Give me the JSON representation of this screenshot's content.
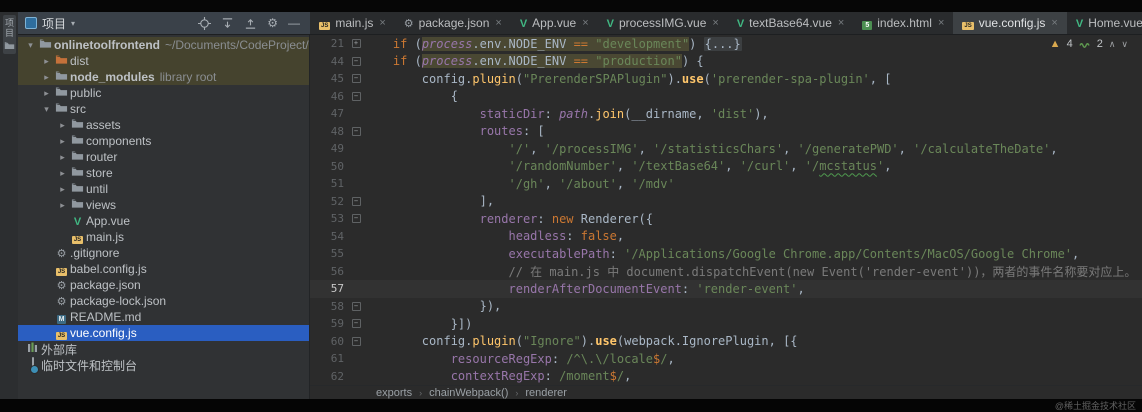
{
  "activity_bar": {
    "stripe_label": "项目"
  },
  "project_panel": {
    "header": {
      "title": "项目",
      "actions": [
        "locate",
        "expand-all",
        "collapse-all",
        "settings",
        "hide-panel"
      ]
    },
    "tree": [
      {
        "label": "onlinetoolfrontend",
        "suffix": "~/Documents/CodeProject/o",
        "icon": "folder",
        "level": 0,
        "chevron": "v",
        "bold": true,
        "hl": true
      },
      {
        "label": "dist",
        "icon": "folder-ex",
        "level": 1,
        "chevron": ">",
        "hl": true
      },
      {
        "label": "node_modules",
        "suffix": "library root",
        "icon": "folder",
        "level": 1,
        "chevron": ">",
        "bold": true,
        "hl": true
      },
      {
        "label": "public",
        "icon": "folder",
        "level": 1,
        "chevron": ">"
      },
      {
        "label": "src",
        "icon": "folder",
        "level": 1,
        "chevron": "v"
      },
      {
        "label": "assets",
        "icon": "folder",
        "level": 2,
        "chevron": ">"
      },
      {
        "label": "components",
        "icon": "folder",
        "level": 2,
        "chevron": ">"
      },
      {
        "label": "router",
        "icon": "folder",
        "level": 2,
        "chevron": ">"
      },
      {
        "label": "store",
        "icon": "folder",
        "level": 2,
        "chevron": ">"
      },
      {
        "label": "until",
        "icon": "folder",
        "level": 2,
        "chevron": ">"
      },
      {
        "label": "views",
        "icon": "folder",
        "level": 2,
        "chevron": ">"
      },
      {
        "label": "App.vue",
        "icon": "vue",
        "level": 2
      },
      {
        "label": "main.js",
        "icon": "js",
        "level": 2
      },
      {
        "label": ".gitignore",
        "icon": "gear",
        "level": 1
      },
      {
        "label": "babel.config.js",
        "icon": "js",
        "level": 1
      },
      {
        "label": "package.json",
        "icon": "json",
        "level": 1
      },
      {
        "label": "package-lock.json",
        "icon": "json",
        "level": 1
      },
      {
        "label": "README.md",
        "icon": "md",
        "level": 1
      },
      {
        "label": "vue.config.js",
        "icon": "js",
        "level": 1,
        "selected": true
      },
      {
        "label": "外部库",
        "icon": "lib",
        "level": 0
      },
      {
        "label": "临时文件和控制台",
        "icon": "scratch",
        "level": 0
      }
    ]
  },
  "editor": {
    "tabs": [
      {
        "label": "main.js",
        "icon": "js"
      },
      {
        "label": "package.json",
        "icon": "json"
      },
      {
        "label": "App.vue",
        "icon": "vue"
      },
      {
        "label": "processIMG.vue",
        "icon": "vue"
      },
      {
        "label": "textBase64.vue",
        "icon": "vue"
      },
      {
        "label": "index.html",
        "icon": "html"
      },
      {
        "label": "vue.config.js",
        "icon": "js",
        "active": true
      },
      {
        "label": "Home.vue",
        "icon": "vue"
      }
    ],
    "inspections": {
      "warnings": "4",
      "typos": "2"
    },
    "breadcrumbs": [
      "exports",
      "chainWebpack()",
      "renderer"
    ],
    "code": {
      "lines": [
        {
          "num": "21",
          "fold": "+",
          "segs": [
            [
              "    ",
              "def"
            ],
            [
              "if ",
              "kw"
            ],
            [
              "(",
              "def"
            ],
            [
              "process",
              "it",
              1
            ],
            [
              ".env.NODE_ENV ",
              "def",
              1
            ],
            [
              "== ",
              "kw",
              1
            ],
            [
              "\"development\"",
              "str",
              1
            ],
            [
              ") ",
              "def"
            ],
            [
              "{...}",
              "fold"
            ]
          ]
        },
        {
          "num": "44",
          "fold": "-",
          "segs": [
            [
              "    ",
              "def"
            ],
            [
              "if ",
              "kw"
            ],
            [
              "(",
              "def"
            ],
            [
              "process",
              "it",
              1
            ],
            [
              ".env.NODE_ENV ",
              "def",
              1
            ],
            [
              "== ",
              "kw",
              1
            ],
            [
              "\"production\"",
              "str",
              1
            ],
            [
              ") {",
              "def"
            ]
          ]
        },
        {
          "num": "45",
          "fold": "-",
          "segs": [
            [
              "        config.",
              "def"
            ],
            [
              "plugin",
              "fn"
            ],
            [
              "(",
              "def"
            ],
            [
              "\"PrerenderSPAPlugin\"",
              "str"
            ],
            [
              ").",
              "def"
            ],
            [
              "use",
              "fnb"
            ],
            [
              "(",
              "def"
            ],
            [
              "'prerender-spa-plugin'",
              "str"
            ],
            [
              ", [",
              "def"
            ]
          ]
        },
        {
          "num": "46",
          "fold": "-",
          "segs": [
            [
              "            {",
              "def"
            ]
          ]
        },
        {
          "num": "47",
          "segs": [
            [
              "                ",
              "def"
            ],
            [
              "staticDir",
              "prop"
            ],
            [
              ": ",
              "def"
            ],
            [
              "path",
              "it"
            ],
            [
              ".",
              "def"
            ],
            [
              "join",
              "fn"
            ],
            [
              "(__dirname, ",
              "def"
            ],
            [
              "'dist'",
              "str"
            ],
            [
              "),",
              "def"
            ]
          ]
        },
        {
          "num": "48",
          "fold": "-",
          "segs": [
            [
              "                ",
              "def"
            ],
            [
              "routes",
              "prop"
            ],
            [
              ": [",
              "def"
            ]
          ]
        },
        {
          "num": "49",
          "segs": [
            [
              "                    ",
              "def"
            ],
            [
              "'/'",
              "str"
            ],
            [
              ", ",
              "def"
            ],
            [
              "'/processIMG'",
              "str"
            ],
            [
              ", ",
              "def"
            ],
            [
              "'/statisticsChars'",
              "str"
            ],
            [
              ", ",
              "def"
            ],
            [
              "'/generatePWD'",
              "str"
            ],
            [
              ", ",
              "def"
            ],
            [
              "'/calculateTheDate'",
              "str"
            ],
            [
              ",",
              "def"
            ]
          ]
        },
        {
          "num": "50",
          "segs": [
            [
              "                    ",
              "def"
            ],
            [
              "'/randomNumber'",
              "str"
            ],
            [
              ", ",
              "def"
            ],
            [
              "'/textBase64'",
              "str"
            ],
            [
              ", ",
              "def"
            ],
            [
              "'/curl'",
              "str"
            ],
            [
              ", ",
              "def"
            ],
            [
              "'/",
              "str"
            ],
            [
              "mcstatus",
              "typo"
            ],
            [
              "'",
              "str"
            ],
            [
              ",",
              "def"
            ]
          ]
        },
        {
          "num": "51",
          "segs": [
            [
              "                    ",
              "def"
            ],
            [
              "'/gh'",
              "str"
            ],
            [
              ", ",
              "def"
            ],
            [
              "'/about'",
              "str"
            ],
            [
              ", ",
              "def"
            ],
            [
              "'/mdv'",
              "str"
            ]
          ]
        },
        {
          "num": "52",
          "fold": "-",
          "segs": [
            [
              "                ],",
              "def"
            ]
          ]
        },
        {
          "num": "53",
          "fold": "-",
          "segs": [
            [
              "                ",
              "def"
            ],
            [
              "renderer",
              "prop"
            ],
            [
              ": ",
              "def"
            ],
            [
              "new ",
              "kw"
            ],
            [
              "Renderer({",
              "def"
            ]
          ]
        },
        {
          "num": "54",
          "segs": [
            [
              "                    ",
              "def"
            ],
            [
              "headless",
              "prop"
            ],
            [
              ": ",
              "def"
            ],
            [
              "false",
              "kw"
            ],
            [
              ",",
              "def"
            ]
          ]
        },
        {
          "num": "55",
          "segs": [
            [
              "                    ",
              "def"
            ],
            [
              "executablePath",
              "prop"
            ],
            [
              ": ",
              "def"
            ],
            [
              "'/Applications/Google Chrome.app/Contents/MacOS/Google Chrome'",
              "str"
            ],
            [
              ",",
              "def"
            ]
          ]
        },
        {
          "num": "56",
          "segs": [
            [
              "                    ",
              "def"
            ],
            [
              "// 在 main.js 中 document.dispatchEvent(new Event('render-event'))，两者的事件名称要对应上。",
              "com"
            ]
          ]
        },
        {
          "num": "57",
          "cur": true,
          "segs": [
            [
              "                    ",
              "def"
            ],
            [
              "renderAfterDocumentEvent",
              "prop"
            ],
            [
              ": ",
              "def"
            ],
            [
              "'render-event'",
              "str"
            ],
            [
              ",",
              "def"
            ]
          ]
        },
        {
          "num": "58",
          "fold": "-",
          "segs": [
            [
              "                }),",
              "def"
            ]
          ]
        },
        {
          "num": "59",
          "fold": "-",
          "segs": [
            [
              "            }])",
              "def"
            ]
          ]
        },
        {
          "num": "60",
          "fold": "-",
          "segs": [
            [
              "        config.",
              "def"
            ],
            [
              "plugin",
              "fn"
            ],
            [
              "(",
              "def"
            ],
            [
              "\"Ignore\"",
              "str"
            ],
            [
              ").",
              "def"
            ],
            [
              "use",
              "fnb"
            ],
            [
              "(webpack.IgnorePlugin, [{",
              "def"
            ]
          ]
        },
        {
          "num": "61",
          "segs": [
            [
              "            ",
              "def"
            ],
            [
              "resourceRegExp",
              "prop"
            ],
            [
              ": ",
              "def"
            ],
            [
              "/^\\.\\/locale",
              "str"
            ],
            [
              "$",
              "kw"
            ],
            [
              "/",
              "str"
            ],
            [
              ",",
              "def"
            ]
          ]
        },
        {
          "num": "62",
          "segs": [
            [
              "            ",
              "def"
            ],
            [
              "contextRegExp",
              "prop"
            ],
            [
              ": ",
              "def"
            ],
            [
              "/moment",
              "str"
            ],
            [
              "$",
              "kw"
            ],
            [
              "/",
              "str"
            ],
            [
              ",",
              "def"
            ]
          ]
        }
      ]
    }
  },
  "watermark": "@稀土掘金技术社区",
  "colors": {
    "selection_blue": "#2a5ec1",
    "occurrence_highlight": "#4a4833",
    "tree_row_highlight": "#45432e",
    "editor_bg": "#2b2b2b",
    "keyword_orange": "#cc7832",
    "string_green": "#6a8759",
    "property_purple": "#9876aa",
    "function_yellow": "#ffc66b"
  }
}
